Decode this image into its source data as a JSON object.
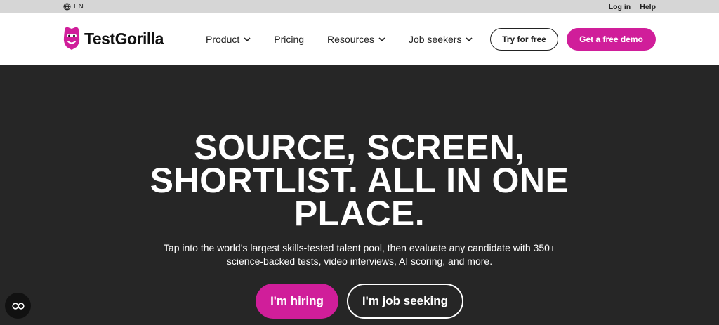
{
  "topbar": {
    "language": "EN",
    "login": "Log in",
    "help": "Help"
  },
  "header": {
    "brand": "TestGorilla",
    "nav": [
      {
        "label": "Product",
        "dropdown": true
      },
      {
        "label": "Pricing",
        "dropdown": false
      },
      {
        "label": "Resources",
        "dropdown": true
      },
      {
        "label": "Job seekers",
        "dropdown": true
      }
    ],
    "try_free": "Try for free",
    "demo": "Get a free demo"
  },
  "hero": {
    "title_line1": "SOURCE, SCREEN,",
    "title_line2": "SHORTLIST. ALL IN ONE",
    "title_line3": "PLACE.",
    "subtitle_line1": "Tap into the world’s largest skills-tested talent pool, then evaluate any candidate with 350+",
    "subtitle_line2": "science-backed tests, video interviews, AI scoring, and more.",
    "cta_hiring": "I'm hiring",
    "cta_seeking": "I'm job seeking"
  },
  "colors": {
    "accent": "#d01e9a",
    "hero_bg": "#262626",
    "topbar_bg": "#d6d6d6"
  },
  "icons": {
    "language": "globe-icon",
    "logo": "gorilla-icon",
    "dropdown": "chevron-down-icon",
    "cookie": "cookie-settings-icon"
  }
}
